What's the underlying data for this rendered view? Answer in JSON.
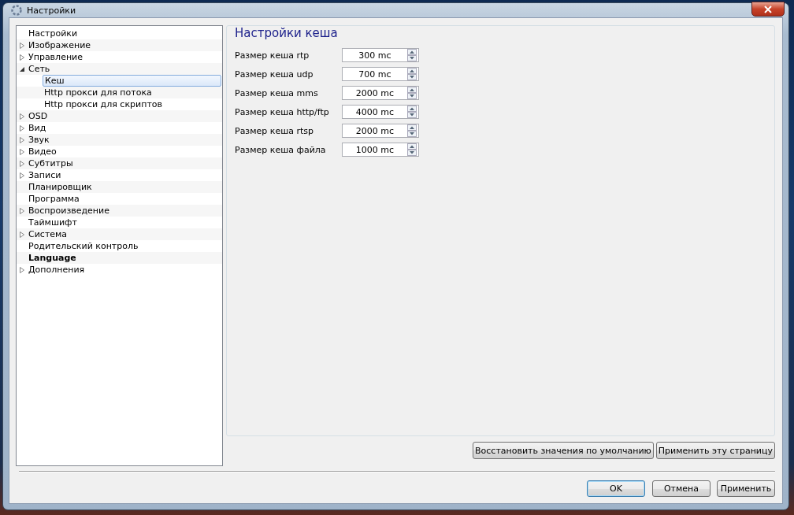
{
  "window": {
    "title": "Настройки"
  },
  "tree": {
    "items": [
      {
        "label": "Настройки",
        "selected": false,
        "bold": false
      },
      {
        "label": "Изображение",
        "selected": false,
        "bold": false,
        "expanded": false
      },
      {
        "label": "Управление",
        "selected": false,
        "bold": false,
        "expanded": false
      },
      {
        "label": "Сеть",
        "selected": false,
        "bold": false,
        "expanded": true,
        "children": [
          {
            "label": "Кеш",
            "selected": true,
            "bold": false
          },
          {
            "label": "Http прокси для потока",
            "selected": false,
            "bold": false
          },
          {
            "label": "Http прокси для скриптов",
            "selected": false,
            "bold": false
          }
        ]
      },
      {
        "label": "OSD",
        "selected": false,
        "bold": false,
        "expanded": false
      },
      {
        "label": "Вид",
        "selected": false,
        "bold": false,
        "expanded": false
      },
      {
        "label": "Звук",
        "selected": false,
        "bold": false,
        "expanded": false
      },
      {
        "label": "Видео",
        "selected": false,
        "bold": false,
        "expanded": false
      },
      {
        "label": "Субтитры",
        "selected": false,
        "bold": false,
        "expanded": false
      },
      {
        "label": "Записи",
        "selected": false,
        "bold": false,
        "expanded": false
      },
      {
        "label": "Планировщик",
        "selected": false,
        "bold": false
      },
      {
        "label": "Программа",
        "selected": false,
        "bold": false
      },
      {
        "label": "Воспроизведение",
        "selected": false,
        "bold": false,
        "expanded": false
      },
      {
        "label": "Таймшифт",
        "selected": false,
        "bold": false
      },
      {
        "label": "Система",
        "selected": false,
        "bold": false,
        "expanded": false
      },
      {
        "label": "Родительский контроль",
        "selected": false,
        "bold": false
      },
      {
        "label": "Language",
        "selected": false,
        "bold": true
      },
      {
        "label": "Дополнения",
        "selected": false,
        "bold": false,
        "expanded": false
      }
    ]
  },
  "group": {
    "title": "Настройки кеша",
    "fields": [
      {
        "label": "Размер кеша rtp",
        "value": "300 mc"
      },
      {
        "label": "Размер кеша udp",
        "value": "700 mc"
      },
      {
        "label": "Размер кеша mms",
        "value": "2000 mc"
      },
      {
        "label": "Размер кеша http/ftp",
        "value": "4000 mc"
      },
      {
        "label": "Размер кеша rtsp",
        "value": "2000 mc"
      },
      {
        "label": "Размер кеша файла",
        "value": "1000 mc"
      }
    ]
  },
  "page_buttons": [
    "Восстановить значения по умолчанию",
    "Применить эту страницу"
  ],
  "dialog_buttons": [
    {
      "label": "OK",
      "selected": true
    },
    {
      "label": "Отмена",
      "selected": false
    },
    {
      "label": "Применить",
      "selected": false
    }
  ]
}
